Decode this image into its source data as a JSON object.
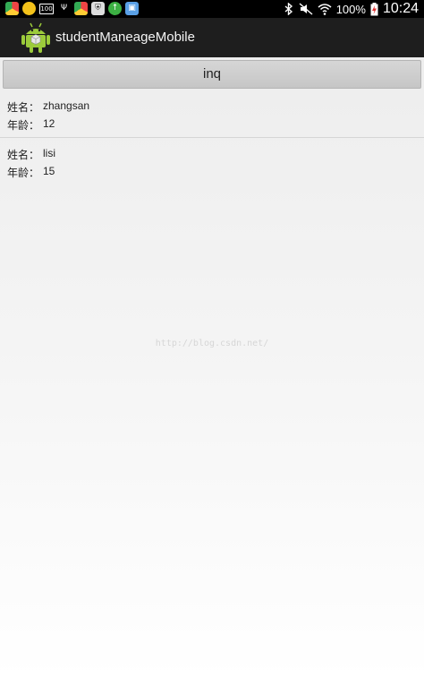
{
  "status_bar": {
    "battery_percent": "100%",
    "time": "10:24",
    "left_icons": [
      "chrome-icon",
      "app-icon",
      "battery-100-icon",
      "usb-icon",
      "chrome-icon",
      "shield-icon",
      "upload-icon",
      "gallery-icon"
    ],
    "battery_level": 100
  },
  "action_bar": {
    "title": "studentManeageMobile"
  },
  "inq_button": {
    "label": "inq"
  },
  "students": [
    {
      "name_label": "姓名：",
      "name": "zhangsan",
      "age_label": "年龄：",
      "age": "12"
    },
    {
      "name_label": "姓名：",
      "name": "lisi",
      "age_label": "年龄：",
      "age": "15"
    }
  ],
  "watermark": "http://blog.csdn.net/",
  "colors": {
    "action_bar_bg": "#1e1e1e",
    "status_bar_bg": "#000000",
    "android_green": "#9ccb3b"
  }
}
